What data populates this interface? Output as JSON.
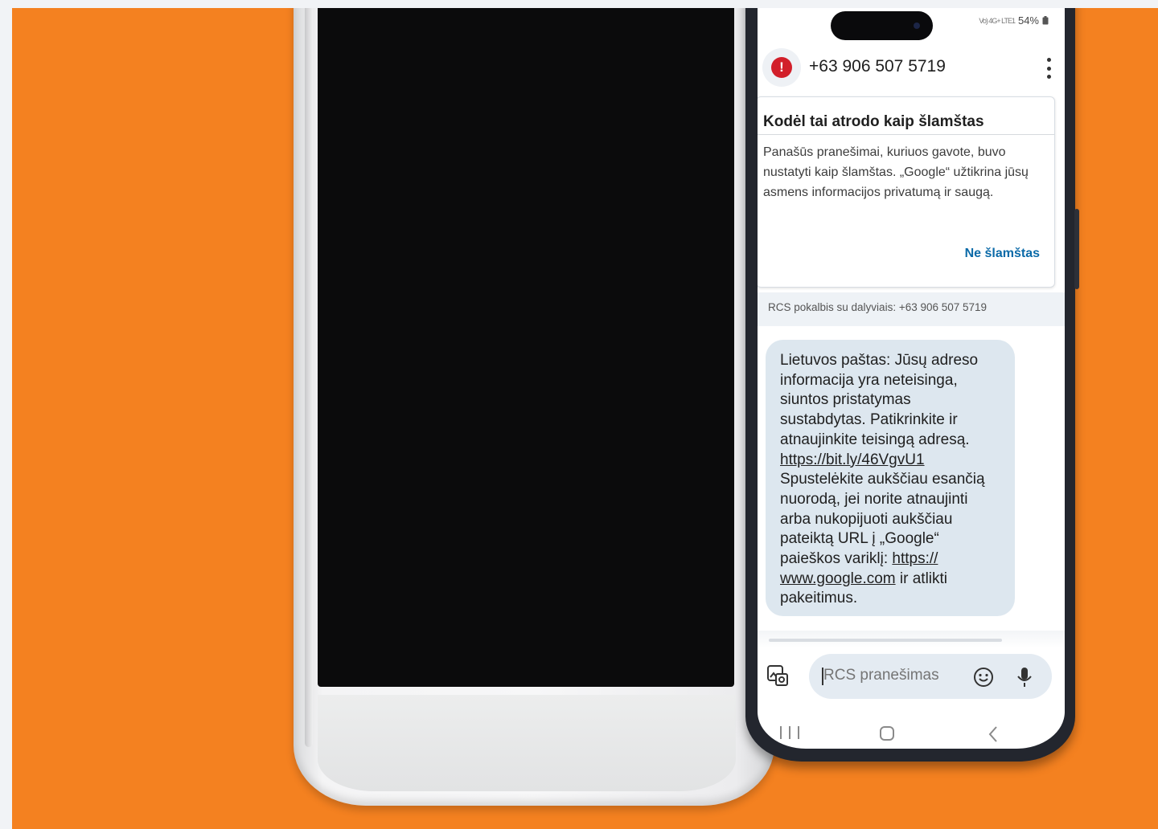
{
  "status_bar": {
    "network": "Vo) 4G+ LTE1",
    "battery": "54%"
  },
  "conversation": {
    "contact_number": "+63 906 507 5719"
  },
  "spam_card": {
    "title": "Kodėl tai atrodo kaip šlamštas",
    "body": "Panašūs pranešimai, kuriuos gavote, buvo nustatyti kaip šlamštas. „Google“ užtikrina jūsų asmens informacijos privatumą ir saugą.",
    "action_label": "Ne šlamštas"
  },
  "rcs_note": "RCS pokalbis su dalyviais: +63 906 507 5719",
  "message": {
    "lines": [
      "Lietuvos paštas: Jūsų adreso",
      "informacija yra neteisinga,",
      "siuntos pristatymas",
      "sustabdytas. Patikrinkite ir",
      "atnaujinkite teisingą adresą."
    ],
    "link_1": "https://bit.ly/46VgvU1",
    "lines_2": [
      "Spustelėkite aukščiau esančią",
      "nuorodą, jei norite atnaujinti",
      "arba nukopijuoti aukščiau",
      "pateiktą URL į „Google“"
    ],
    "search_prefix": "paieškos variklį: ",
    "link_2_part_1": "https://",
    "link_2_part_2": "www.google.com",
    "after_link": " ir atlikti",
    "last_line": "pakeitimus."
  },
  "composer": {
    "placeholder": "RCS pranešimas"
  },
  "icons": {
    "alert": "alert-icon",
    "more": "more-vert-icon",
    "attach": "gallery-attach-icon",
    "emoji": "emoji-icon",
    "mic": "mic-icon",
    "recents": "recents-icon",
    "home": "home-icon",
    "back": "back-icon"
  },
  "colors": {
    "background": "#f48120",
    "alert_red": "#d21f2a",
    "link_blue": "#0b6aa8",
    "bubble": "#dde7ef"
  }
}
